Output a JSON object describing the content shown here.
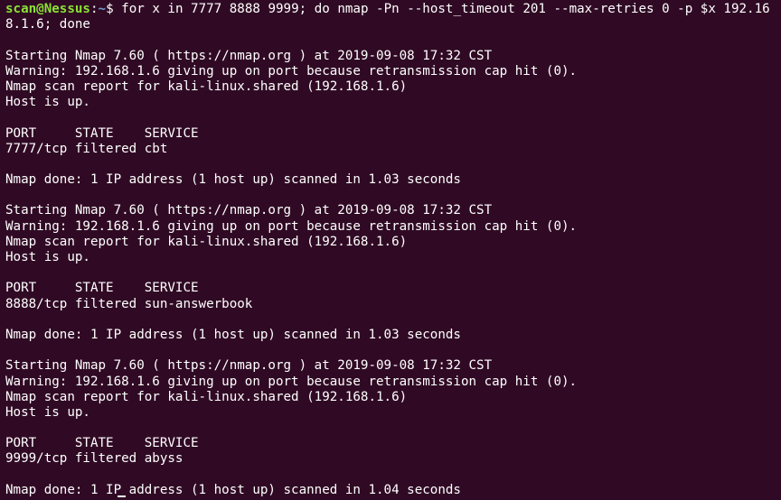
{
  "window": {
    "background_color": "#300a24",
    "text_color": "#ffffff",
    "prompt_user_color": "#8ae234",
    "prompt_path_color": "#729fcf"
  },
  "prompt": {
    "user_host": "scan@Nessus",
    "separator": ":",
    "path": "~",
    "symbol": "$ "
  },
  "command": {
    "line1": "for x in 7777 8888 9999; do nmap -Pn --host_timeout 201 --max-retries 0 -p $x 192.16",
    "line2": "8.1.6; done"
  },
  "scans": [
    {
      "starting": "Starting Nmap 7.60 ( https://nmap.org ) at 2019-09-08 17:32 CST",
      "warning": "Warning: 192.168.1.6 giving up on port because retransmission cap hit (0).",
      "report": "Nmap scan report for kali-linux.shared (192.168.1.6)",
      "host_status": "Host is up.",
      "table_header": "PORT     STATE    SERVICE",
      "port_row": "7777/tcp filtered cbt",
      "done": "Nmap done: 1 IP address (1 host up) scanned in 1.03 seconds"
    },
    {
      "starting": "Starting Nmap 7.60 ( https://nmap.org ) at 2019-09-08 17:32 CST",
      "warning": "Warning: 192.168.1.6 giving up on port because retransmission cap hit (0).",
      "report": "Nmap scan report for kali-linux.shared (192.168.1.6)",
      "host_status": "Host is up.",
      "table_header": "PORT     STATE    SERVICE",
      "port_row": "8888/tcp filtered sun-answerbook",
      "done": "Nmap done: 1 IP address (1 host up) scanned in 1.03 seconds"
    },
    {
      "starting": "Starting Nmap 7.60 ( https://nmap.org ) at 2019-09-08 17:32 CST",
      "warning": "Warning: 192.168.1.6 giving up on port because retransmission cap hit (0).",
      "report": "Nmap scan report for kali-linux.shared (192.168.1.6)",
      "host_status": "Host is up.",
      "table_header": "PORT     STATE    SERVICE",
      "port_row": "9999/tcp filtered abyss",
      "done": "Nmap done: 1 IP address (1 host up) scanned in 1.04 seconds"
    }
  ]
}
